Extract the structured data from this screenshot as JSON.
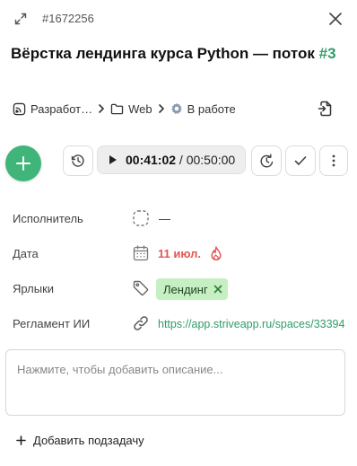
{
  "header": {
    "task_id": "#1672256"
  },
  "task": {
    "title": "Вёрстка лендинга курса Python — поток ",
    "title_number": "#3"
  },
  "breadcrumb": {
    "space": "Разработ…",
    "folder": "Web",
    "status": "В работе"
  },
  "timer": {
    "elapsed": "00:41:02",
    "separator": " / ",
    "estimate": "00:50:00"
  },
  "properties": {
    "assignee_label": "Исполнитель",
    "assignee_value": "—",
    "date_label": "Дата",
    "date_value": "11 июл.",
    "tags_label": "Ярлыки",
    "tag_value": "Лендинг",
    "regulation_label": "Регламент ИИ",
    "regulation_value": "https://app.striveapp.ru/spaces/33394"
  },
  "description": {
    "placeholder": "Нажмите, чтобы добавить описание..."
  },
  "subtask": {
    "label": "Добавить подзадачу"
  },
  "colors": {
    "accent_green": "#3fb57a",
    "link_green": "#2e9d66",
    "date_red": "#e25555",
    "tag_bg": "#c6efc3"
  },
  "icons": [
    "expand-icon",
    "close-icon",
    "feed-icon",
    "folder-icon",
    "gear-icon",
    "export-icon",
    "plus-icon",
    "history-icon",
    "play-icon",
    "time-log-icon",
    "check-icon",
    "more-icon",
    "user-placeholder-icon",
    "calendar-icon",
    "fire-icon",
    "tag-icon",
    "link-icon"
  ]
}
